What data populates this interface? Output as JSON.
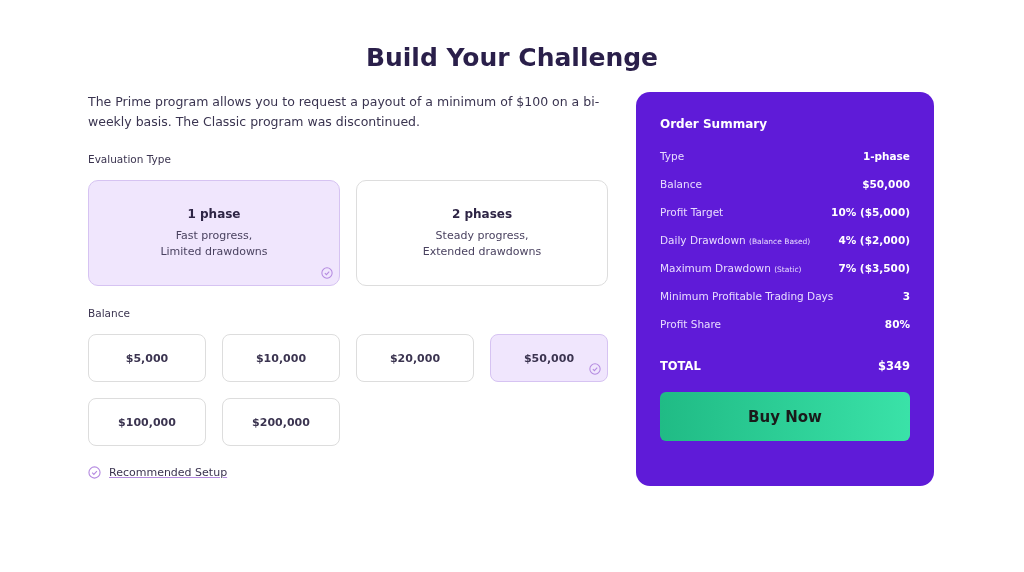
{
  "title": "Build Your Challenge",
  "intro": "The Prime program allows you to request a payout of a minimum of $100 on a bi-weekly basis. The Classic program was discontinued.",
  "evaluation": {
    "label": "Evaluation Type",
    "options": [
      {
        "title": "1 phase",
        "lines": [
          "Fast progress,",
          "Limited drawdowns"
        ],
        "selected": true
      },
      {
        "title": "2 phases",
        "lines": [
          "Steady progress,",
          "Extended drawdowns"
        ],
        "selected": false
      }
    ]
  },
  "balance": {
    "label": "Balance",
    "options": [
      {
        "label": "$5,000",
        "selected": false
      },
      {
        "label": "$10,000",
        "selected": false
      },
      {
        "label": "$20,000",
        "selected": false
      },
      {
        "label": "$50,000",
        "selected": true
      },
      {
        "label": "$100,000",
        "selected": false
      },
      {
        "label": "$200,000",
        "selected": false
      }
    ]
  },
  "recommended": {
    "label": "Recommended Setup",
    "checked": true
  },
  "summary": {
    "title": "Order Summary",
    "rows": [
      {
        "label": "Type",
        "value": "1-phase"
      },
      {
        "label": "Balance",
        "value": "$50,000"
      },
      {
        "label": "Profit Target",
        "value": "10% ($5,000)"
      },
      {
        "label": "Daily Drawdown",
        "note": "(Balance Based)",
        "value": "4% ($2,000)"
      },
      {
        "label": "Maximum Drawdown",
        "note": "(Static)",
        "value": "7% ($3,500)"
      },
      {
        "label": "Minimum Profitable Trading Days",
        "value": "3"
      },
      {
        "label": "Profit Share",
        "value": "80%"
      }
    ],
    "total": {
      "label": "TOTAL",
      "value": "$349"
    },
    "button": "Buy Now"
  }
}
